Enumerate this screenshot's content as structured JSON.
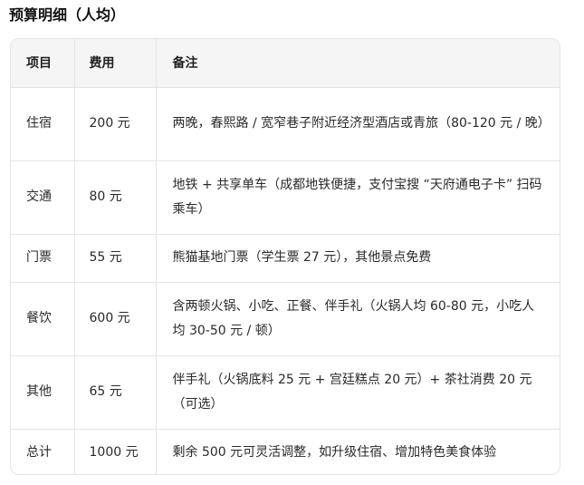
{
  "title": "预算明细（人均）",
  "table": {
    "headers": [
      "项目",
      "费用",
      "备注"
    ],
    "rows": [
      {
        "item": "住宿",
        "cost": "200 元",
        "note": "两晚，春熙路 / 宽窄巷子附近经济型酒店或青旅（80-120 元 / 晚）"
      },
      {
        "item": "交通",
        "cost": "80 元",
        "note": "地铁 + 共享单车（成都地铁便捷，支付宝搜 “天府通电子卡” 扫码乘车）"
      },
      {
        "item": "门票",
        "cost": "55 元",
        "note": "熊猫基地门票（学生票 27 元），其他景点免费"
      },
      {
        "item": "餐饮",
        "cost": "600 元",
        "note": "含两顿火锅、小吃、正餐、伴手礼（火锅人均 60-80 元，小吃人均 30-50 元 / 顿）"
      },
      {
        "item": "其他",
        "cost": "65 元",
        "note": "伴手礼（火锅底料 25 元 + 宫廷糕点 20 元）+ 茶社消费 20 元（可选）"
      },
      {
        "item": "总计",
        "cost": "1000 元",
        "note": "剩余 500 元可灵活调整，如升级住宿、增加特色美食体验"
      }
    ]
  }
}
